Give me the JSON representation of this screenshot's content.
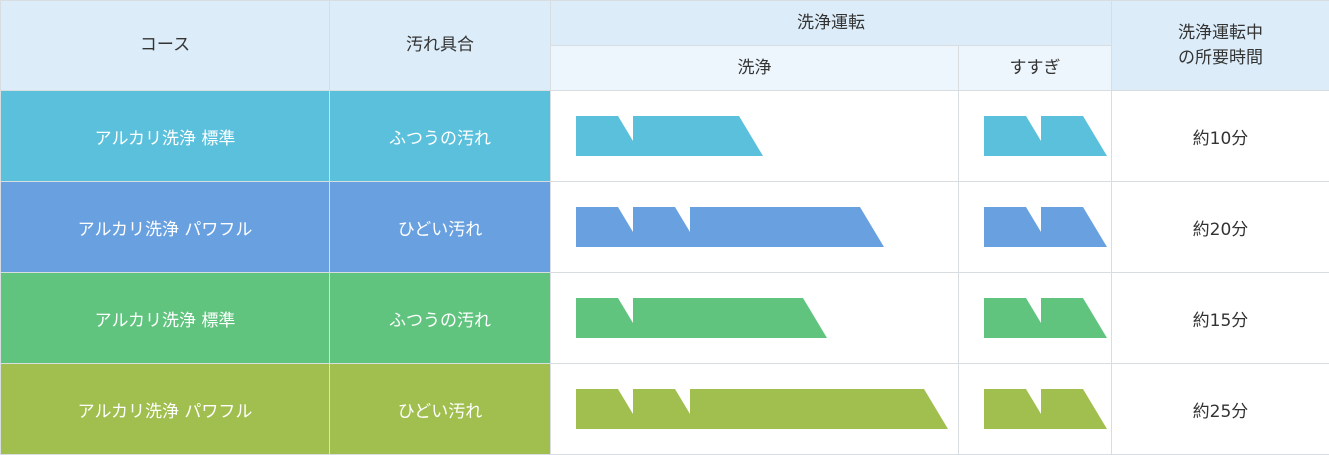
{
  "headers": {
    "course": "コース",
    "soil": "汚れ具合",
    "operation": "洗浄運転",
    "wash": "洗浄",
    "rinse": "すすぎ",
    "duration_line1": "洗浄運転中",
    "duration_line2": "の所要時間"
  },
  "rows": [
    {
      "course": "アルカリ洗浄 標準",
      "soil": "ふつうの汚れ",
      "time": "約10分",
      "color": "#5bc0dc",
      "wash": [
        1,
        2
      ],
      "rinse": [
        1,
        1
      ]
    },
    {
      "course": "アルカリ洗浄 パワフル",
      "soil": "ひどい汚れ",
      "time": "約20分",
      "color": "#69a1e0",
      "wash": [
        1,
        1,
        3
      ],
      "rinse": [
        1,
        1
      ]
    },
    {
      "course": "アルカリ洗浄 標準",
      "soil": "ふつうの汚れ",
      "time": "約15分",
      "color": "#60c47f",
      "wash": [
        1,
        3
      ],
      "rinse": [
        1,
        1
      ]
    },
    {
      "course": "アルカリ洗浄 パワフル",
      "soil": "ひどい汚れ",
      "time": "約25分",
      "color": "#a1bf4f",
      "wash": [
        1,
        1,
        4
      ],
      "rinse": [
        1,
        1
      ]
    }
  ]
}
